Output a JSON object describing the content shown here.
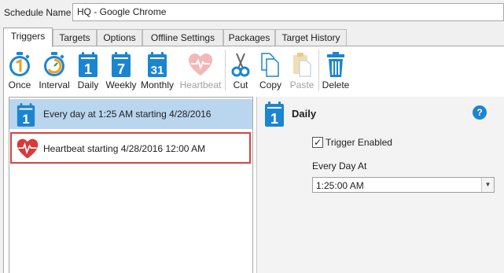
{
  "schedule": {
    "name_label": "Schedule Name",
    "name_value": "HQ - Google Chrome"
  },
  "tabs": [
    {
      "label": "Triggers",
      "active": true
    },
    {
      "label": "Targets"
    },
    {
      "label": "Options"
    },
    {
      "label": "Offline Settings"
    },
    {
      "label": "Packages"
    },
    {
      "label": "Target History"
    }
  ],
  "toolbar": {
    "once": "Once",
    "interval": "Interval",
    "daily": "Daily",
    "weekly": "Weekly",
    "monthly": "Monthly",
    "heartbeat": "Heartbeat",
    "cut": "Cut",
    "copy": "Copy",
    "paste": "Paste",
    "delete": "Delete",
    "daily_icon_text": "1",
    "weekly_icon_text": "7",
    "monthly_icon_text": "31"
  },
  "triggers": [
    {
      "text": "Every day at 1:25 AM starting 4/28/2016",
      "icon": "daily-calendar-icon",
      "selected": true,
      "icon_text": "1"
    },
    {
      "text": "Heartbeat starting 4/28/2016 12:00 AM",
      "icon": "heartbeat-icon",
      "selected": false
    }
  ],
  "detail": {
    "title": "Daily",
    "icon_text": "1",
    "help": "?",
    "trigger_enabled_label": "Trigger Enabled",
    "trigger_enabled_mark": "✓",
    "trigger_enabled": true,
    "every_day_at_label": "Every Day At",
    "time_value": "1:25:00 AM",
    "time_arrow": "▼"
  },
  "colors": {
    "accent": "#1c85d0",
    "selection": "#b9d6ee",
    "highlight": "#d84040",
    "heart": "#d83a3a"
  }
}
